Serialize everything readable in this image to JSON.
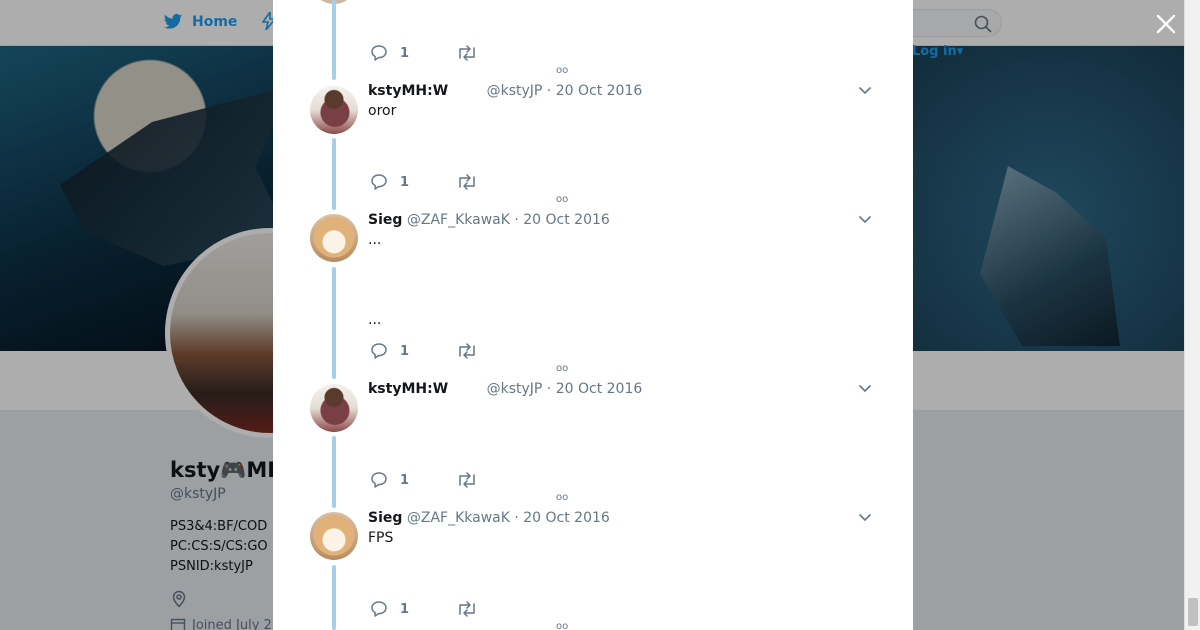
{
  "topbar": {
    "home_label": "Home",
    "login_label": "Log in",
    "login_caret": "▾"
  },
  "profile": {
    "name": "ksty🎮MH",
    "handle": "@kstyJP",
    "bio_lines": [
      "PS3&4:BF/COD",
      "PC:CS:S/CS:GO",
      "PSNID:kstyJP"
    ],
    "joined": "Joined July 2"
  },
  "colors": {
    "accent": "#1da1f2",
    "thread_line": "#a6d0e7",
    "meta_text": "#657786"
  },
  "tweets": [
    {
      "display_name": "kstyMH:W",
      "meta": "@kstyJP · 20 Oct 2016",
      "lines": [
        "oror"
      ],
      "reply_count": "1",
      "avatar": "ksty-avatar"
    },
    {
      "display_name": "Sieg",
      "meta": "@ZAF_KkawaK · 20 Oct 2016",
      "lines": [
        "...",
        "..."
      ],
      "reply_count": "1",
      "avatar": "sieg-avatar"
    },
    {
      "display_name": "kstyMH:W",
      "meta": "@kstyJP · 20 Oct 2016",
      "lines": [],
      "reply_count": "1",
      "avatar": "ksty-avatar"
    },
    {
      "display_name": "Sieg",
      "meta": "@ZAF_KkawaK · 20 Oct 2016",
      "lines": [
        "FPS"
      ],
      "reply_count": "1",
      "avatar": "sieg-avatar"
    }
  ],
  "first_reply_count": "1",
  "more_indicator": "oo",
  "icons": {
    "close": "close-icon",
    "reply": "reply-icon",
    "retweet": "retweet-icon",
    "caret": "chevron-down-icon",
    "search": "search-icon",
    "twitter": "twitter-bird-icon",
    "location": "location-pin-icon",
    "calendar": "calendar-icon"
  }
}
